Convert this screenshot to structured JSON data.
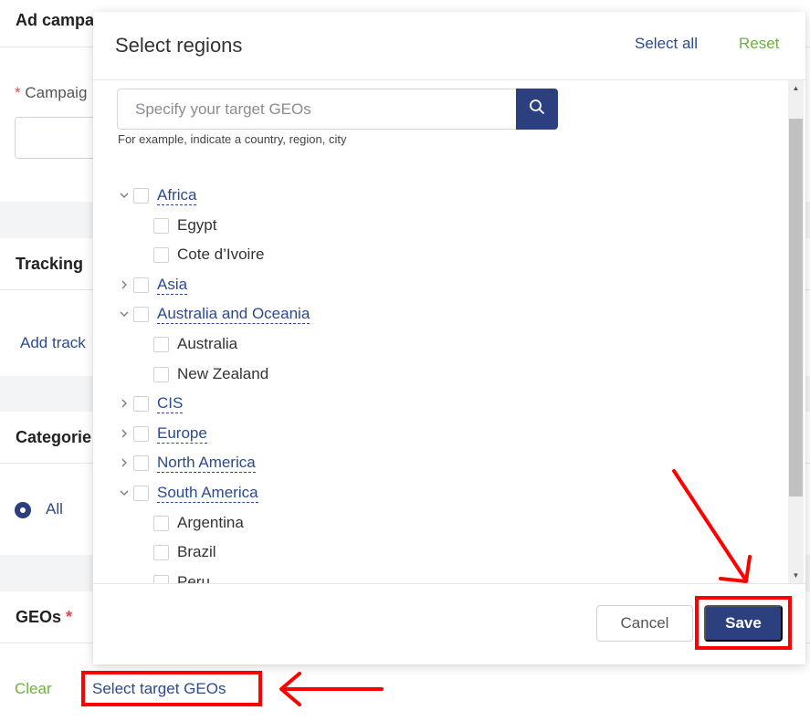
{
  "background": {
    "ad_campaign_title": "Ad campa",
    "campaign_label_prefix": "*",
    "campaign_label": "Campaig",
    "tracking_title": "Tracking",
    "add_tracking_link": "Add track",
    "categories_title": "Categorie",
    "all_label": "All",
    "geos_title": "GEOs",
    "geos_required": "*",
    "clear_link": "Clear",
    "select_target_link": "Select target GEOs"
  },
  "modal": {
    "title": "Select regions",
    "select_all": "Select all",
    "reset": "Reset",
    "search_placeholder": "Specify your target GEOs",
    "hint": "For example, indicate a country, region, city",
    "tree": [
      {
        "label": "Africa",
        "expanded": true,
        "children": [
          "Egypt",
          "Cote d’Ivoire"
        ]
      },
      {
        "label": "Asia",
        "expanded": false,
        "children": []
      },
      {
        "label": "Australia and Oceania",
        "expanded": true,
        "children": [
          "Australia",
          "New Zealand"
        ]
      },
      {
        "label": "CIS",
        "expanded": false,
        "children": []
      },
      {
        "label": "Europe",
        "expanded": false,
        "children": []
      },
      {
        "label": "North America",
        "expanded": false,
        "children": []
      },
      {
        "label": "South America",
        "expanded": true,
        "children": [
          "Argentina",
          "Brazil",
          "Peru"
        ]
      }
    ],
    "cancel": "Cancel",
    "save": "Save"
  },
  "colors": {
    "primary": "#2c3f7f",
    "link": "#2c4a8f",
    "green": "#6db33f",
    "highlight": "#ff0000"
  }
}
